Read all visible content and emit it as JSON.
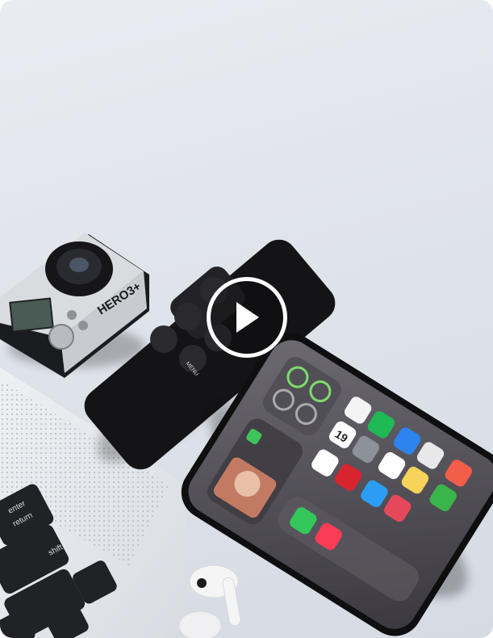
{
  "video": {
    "camera_brand": "HERO3+",
    "remote_button_label": "MENU",
    "keyboard_keys": [
      "enter",
      "return",
      "shift"
    ],
    "phone_date": "19",
    "play_icon": "play-icon"
  }
}
